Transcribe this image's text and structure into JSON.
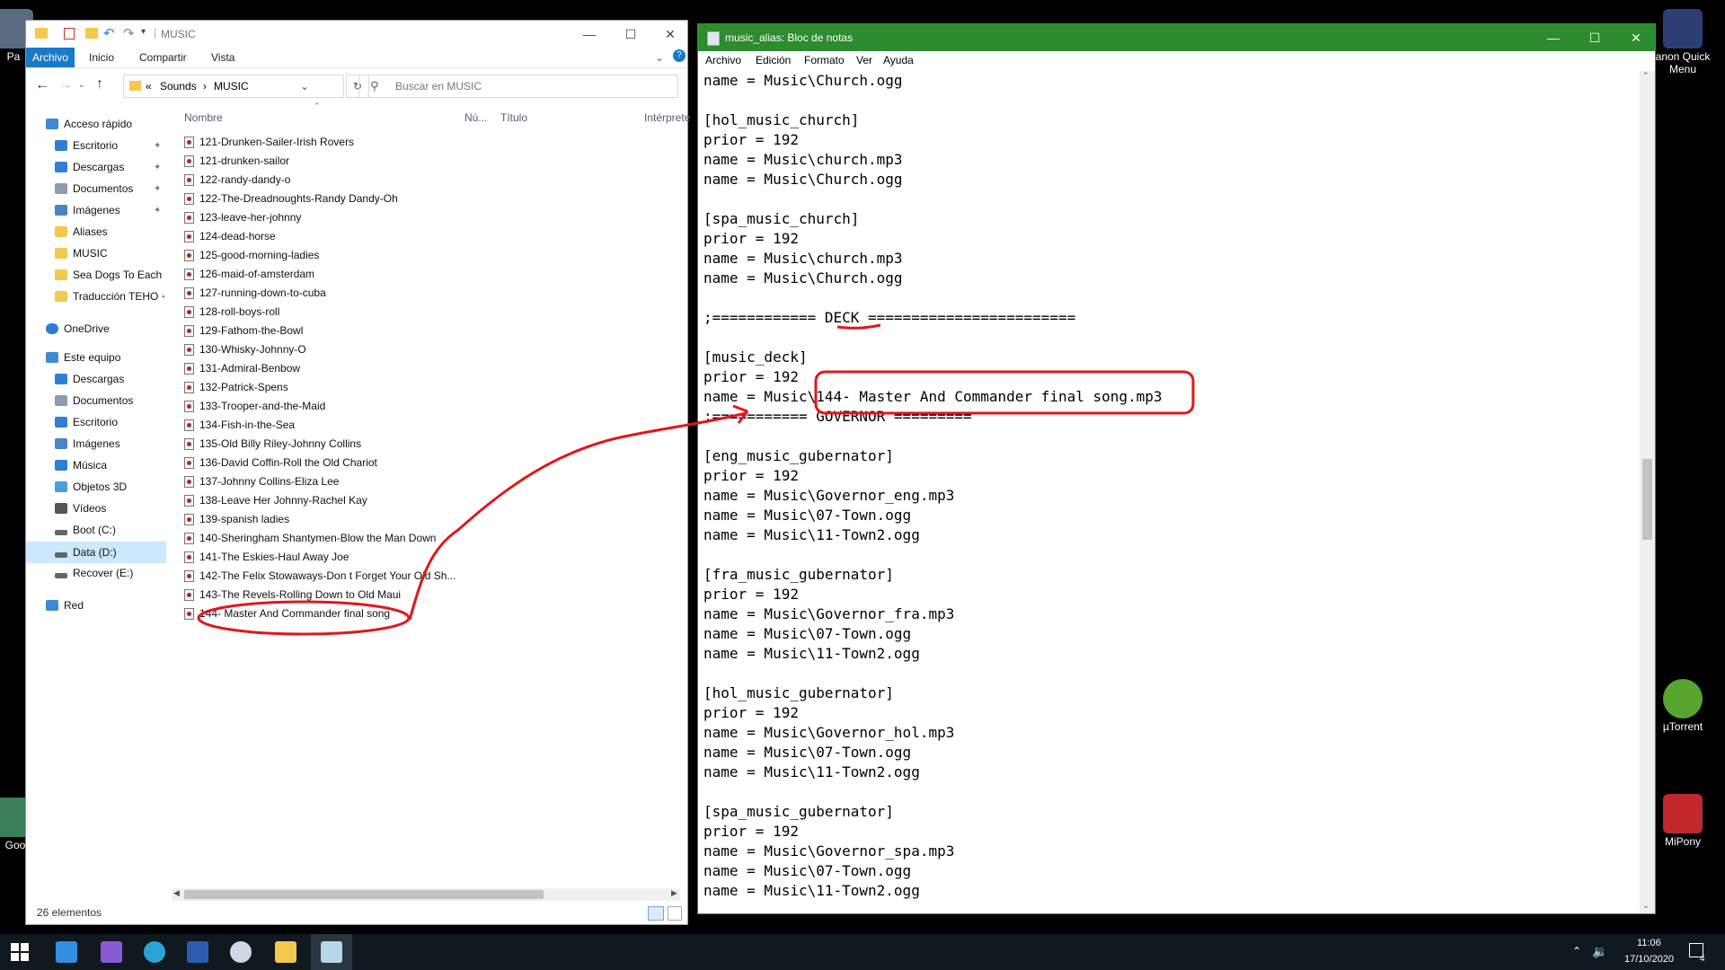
{
  "desktop": {
    "icons": [
      {
        "label": "Pa",
        "color": "#5a6b80"
      },
      {
        "label": "anon Quick Menu",
        "color": "#2b3f74"
      },
      {
        "label": "µTorrent",
        "color": "#57a52e"
      },
      {
        "label": "MiPony",
        "color": "#c0282c"
      },
      {
        "label": "Goo",
        "color": "#3a7f5a"
      }
    ]
  },
  "explorer": {
    "title": "MUSIC",
    "ribbon_tabs": [
      "Archivo",
      "Inicio",
      "Compartir",
      "Vista"
    ],
    "breadcrumb": [
      "«",
      "Sounds",
      "›",
      "MUSIC"
    ],
    "search_placeholder": "Buscar en MUSIC",
    "columns": [
      "Nombre",
      "Nú...",
      "Título",
      "Intérprete"
    ],
    "nav": [
      {
        "label": "Acceso rápido",
        "icon": "star-icon",
        "color": "#3a8ad6"
      },
      {
        "label": "Escritorio",
        "icon": "desktop-icon",
        "color": "#2d7fd3",
        "pinned": true
      },
      {
        "label": "Descargas",
        "icon": "download-icon",
        "color": "#2d7fd3",
        "pinned": true
      },
      {
        "label": "Documentos",
        "icon": "document-icon",
        "color": "#8b9bb0",
        "pinned": true
      },
      {
        "label": "Imágenes",
        "icon": "picture-icon",
        "color": "#4a84c4",
        "pinned": true
      },
      {
        "label": "Aliases",
        "icon": "folder-icon",
        "color": "#f2c94c"
      },
      {
        "label": "MUSIC",
        "icon": "folder-icon",
        "color": "#f2c94c"
      },
      {
        "label": "Sea Dogs To Each H",
        "icon": "folder-icon",
        "color": "#f2c94c"
      },
      {
        "label": "Traducción TEHO +",
        "icon": "folder-icon",
        "color": "#f2c94c"
      },
      {
        "label": "OneDrive",
        "icon": "cloud-icon",
        "color": "#2f7ad8"
      },
      {
        "label": "Este equipo",
        "icon": "computer-icon",
        "color": "#3a8ad6"
      },
      {
        "label": "Descargas",
        "icon": "download-icon",
        "color": "#2d7fd3"
      },
      {
        "label": "Documentos",
        "icon": "document-icon",
        "color": "#8b9bb0"
      },
      {
        "label": "Escritorio",
        "icon": "desktop-icon",
        "color": "#2d7fd3"
      },
      {
        "label": "Imágenes",
        "icon": "picture-icon",
        "color": "#4a84c4"
      },
      {
        "label": "Música",
        "icon": "music-icon",
        "color": "#2d7fd3"
      },
      {
        "label": "Objetos 3D",
        "icon": "cube-icon",
        "color": "#49a0d8"
      },
      {
        "label": "Vídeos",
        "icon": "video-icon",
        "color": "#555555"
      },
      {
        "label": "Boot (C:)",
        "icon": "drive-icon",
        "color": "#666666"
      },
      {
        "label": "Data (D:)",
        "icon": "drive-icon",
        "color": "#666666",
        "selected": true
      },
      {
        "label": "Recover (E:)",
        "icon": "drive-icon",
        "color": "#666666"
      },
      {
        "label": "Red",
        "icon": "network-icon",
        "color": "#3a8ad6"
      }
    ],
    "files": [
      "121-Drunken-Sailer-Irish Rovers",
      "121-drunken-sailor",
      "122-randy-dandy-o",
      "122-The-Dreadnoughts-Randy Dandy-Oh",
      "123-leave-her-johnny",
      "124-dead-horse",
      "125-good-morning-ladies",
      "126-maid-of-amsterdam",
      "127-running-down-to-cuba",
      "128-roll-boys-roll",
      "129-Fathom-the-Bowl",
      "130-Whisky-Johnny-O",
      "131-Admiral-Benbow",
      "132-Patrick-Spens",
      "133-Trooper-and-the-Maid",
      "134-Fish-in-the-Sea",
      "135-Old Billy Riley-Johnny Collins",
      "136-David Coffin-Roll the Old Chariot",
      "137-Johnny Collins-Eliza Lee",
      "138-Leave Her Johnny-Rachel Kay",
      "139-spanish ladies",
      "140-Sheringham Shantymen-Blow the Man Down",
      "141-The Eskies-Haul Away Joe",
      "142-The Felix Stowaways-Don t Forget Your Old Sh...",
      "143-The Revels-Rolling Down to Old Maui",
      "144- Master And Commander final song"
    ],
    "status": "26 elementos"
  },
  "notepad": {
    "title": "music_alias: Bloc de notas",
    "menu": [
      "Archivo",
      "Edición",
      "Formato",
      "Ver",
      "Ayuda"
    ],
    "lines": [
      "name = Music\\Church.ogg",
      "",
      "[hol_music_church]",
      "prior = 192",
      "name = Music\\church.mp3",
      "name = Music\\Church.ogg",
      "",
      "[spa_music_church]",
      "prior = 192",
      "name = Music\\church.mp3",
      "name = Music\\Church.ogg",
      "",
      ";============ DECK ========================",
      "",
      "[music_deck]",
      "prior = 192",
      "name = Music\\144- Master And Commander final song.mp3",
      ";=========== GOVERNOR =========",
      "",
      "[eng_music_gubernator]",
      "prior = 192",
      "name = Music\\Governor_eng.mp3",
      "name = Music\\07-Town.ogg",
      "name = Music\\11-Town2.ogg",
      "",
      "[fra_music_gubernator]",
      "prior = 192",
      "name = Music\\Governor_fra.mp3",
      "name = Music\\07-Town.ogg",
      "name = Music\\11-Town2.ogg",
      "",
      "[hol_music_gubernator]",
      "prior = 192",
      "name = Music\\Governor_hol.mp3",
      "name = Music\\07-Town.ogg",
      "name = Music\\11-Town2.ogg",
      "",
      "[spa_music_gubernator]",
      "prior = 192",
      "name = Music\\Governor_spa.mp3",
      "name = Music\\07-Town.ogg",
      "name = Music\\11-Town2.ogg"
    ]
  },
  "taskbar": {
    "apps": [
      {
        "name": "start-icon",
        "color": "#ffffff"
      },
      {
        "name": "mail-icon",
        "color": "#2f8fe0"
      },
      {
        "name": "visual-studio-icon",
        "color": "#8a5bd6"
      },
      {
        "name": "edge-icon",
        "color": "#2aa3d8"
      },
      {
        "name": "word-icon",
        "color": "#2b5caf"
      },
      {
        "name": "steam-icon",
        "color": "#cfd8e3"
      },
      {
        "name": "file-explorer-icon",
        "color": "#f2c94c"
      },
      {
        "name": "notepad-icon",
        "color": "#b7d6e8"
      }
    ],
    "time": "11:06",
    "date": "17/10/2020",
    "notifications": "4"
  },
  "annotation_color": "#e0171d"
}
